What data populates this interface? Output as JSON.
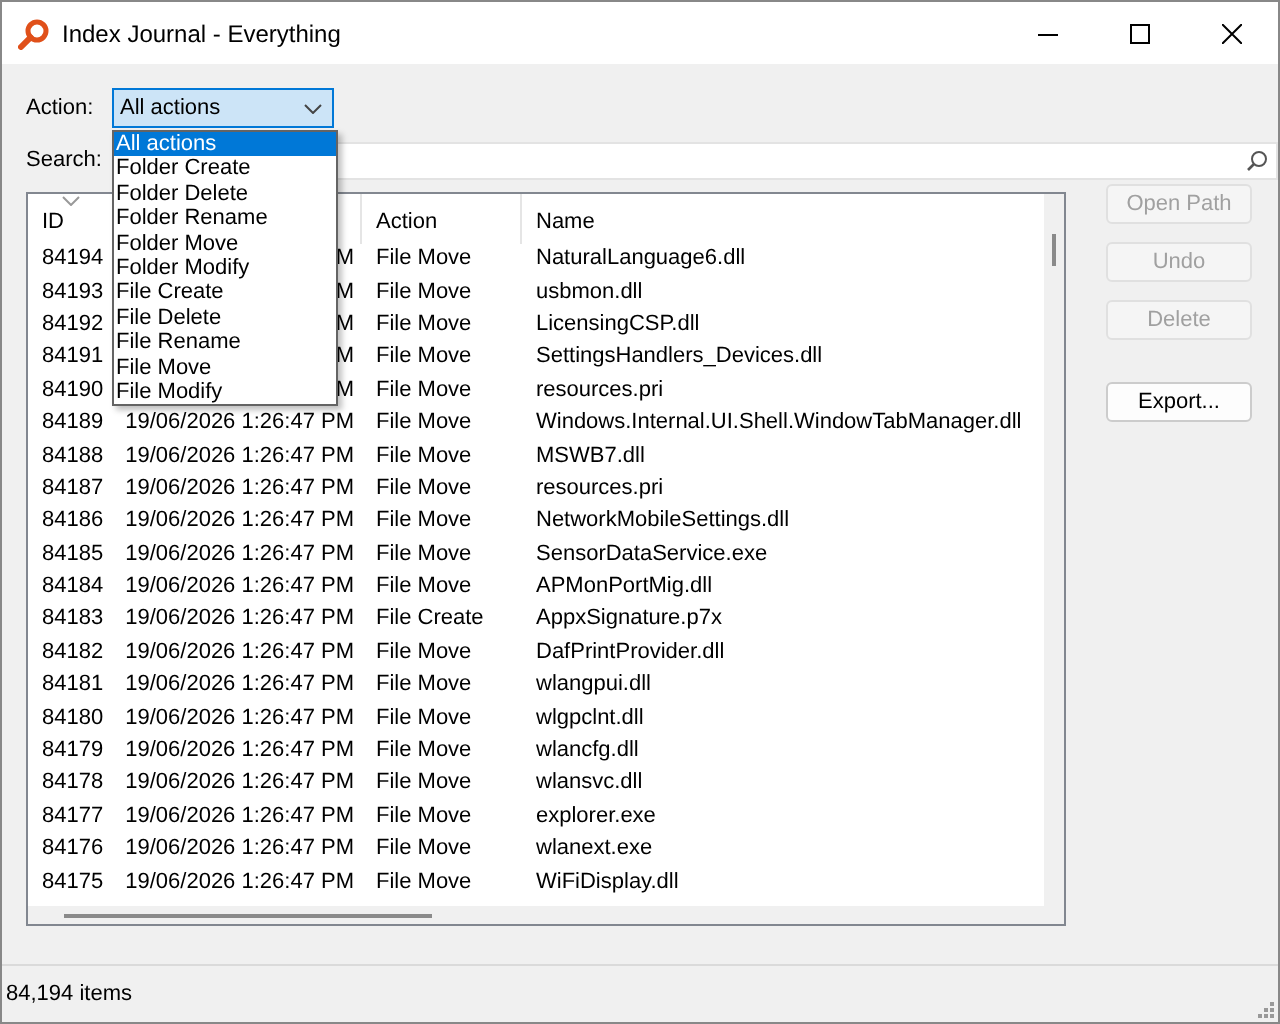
{
  "window": {
    "title": "Index Journal - Everything"
  },
  "action_filter": {
    "label": "Action:",
    "value": "All actions",
    "expanded": true,
    "options": [
      {
        "label": "All actions",
        "selected": true
      },
      {
        "label": "Folder Create",
        "selected": false
      },
      {
        "label": "Folder Delete",
        "selected": false
      },
      {
        "label": "Folder Rename",
        "selected": false
      },
      {
        "label": "Folder Move",
        "selected": false
      },
      {
        "label": "Folder Modify",
        "selected": false
      },
      {
        "label": "File Create",
        "selected": false
      },
      {
        "label": "File Delete",
        "selected": false
      },
      {
        "label": "File Rename",
        "selected": false
      },
      {
        "label": "File Move",
        "selected": false
      },
      {
        "label": "File Modify",
        "selected": false
      }
    ]
  },
  "search": {
    "label": "Search:"
  },
  "table": {
    "columns": [
      "ID",
      "",
      "Action",
      "Name"
    ],
    "rows": [
      {
        "id": "84194",
        "date": "M",
        "action": "File Move",
        "name": "NaturalLanguage6.dll"
      },
      {
        "id": "84193",
        "date": "M",
        "action": "File Move",
        "name": "usbmon.dll"
      },
      {
        "id": "84192",
        "date": "M",
        "action": "File Move",
        "name": "LicensingCSP.dll"
      },
      {
        "id": "84191",
        "date": "M",
        "action": "File Move",
        "name": "SettingsHandlers_Devices.dll"
      },
      {
        "id": "84190",
        "date": "M",
        "action": "File Move",
        "name": "resources.pri"
      },
      {
        "id": "84189",
        "date": "19/06/2026 1:26:47 PM",
        "action": "File Move",
        "name": "Windows.Internal.UI.Shell.WindowTabManager.dll"
      },
      {
        "id": "84188",
        "date": "19/06/2026 1:26:47 PM",
        "action": "File Move",
        "name": "MSWB7.dll"
      },
      {
        "id": "84187",
        "date": "19/06/2026 1:26:47 PM",
        "action": "File Move",
        "name": "resources.pri"
      },
      {
        "id": "84186",
        "date": "19/06/2026 1:26:47 PM",
        "action": "File Move",
        "name": "NetworkMobileSettings.dll"
      },
      {
        "id": "84185",
        "date": "19/06/2026 1:26:47 PM",
        "action": "File Move",
        "name": "SensorDataService.exe"
      },
      {
        "id": "84184",
        "date": "19/06/2026 1:26:47 PM",
        "action": "File Move",
        "name": "APMonPortMig.dll"
      },
      {
        "id": "84183",
        "date": "19/06/2026 1:26:47 PM",
        "action": "File Create",
        "name": "AppxSignature.p7x"
      },
      {
        "id": "84182",
        "date": "19/06/2026 1:26:47 PM",
        "action": "File Move",
        "name": "DafPrintProvider.dll"
      },
      {
        "id": "84181",
        "date": "19/06/2026 1:26:47 PM",
        "action": "File Move",
        "name": "wlangpui.dll"
      },
      {
        "id": "84180",
        "date": "19/06/2026 1:26:47 PM",
        "action": "File Move",
        "name": "wlgpclnt.dll"
      },
      {
        "id": "84179",
        "date": "19/06/2026 1:26:47 PM",
        "action": "File Move",
        "name": "wlancfg.dll"
      },
      {
        "id": "84178",
        "date": "19/06/2026 1:26:47 PM",
        "action": "File Move",
        "name": "wlansvc.dll"
      },
      {
        "id": "84177",
        "date": "19/06/2026 1:26:47 PM",
        "action": "File Move",
        "name": "explorer.exe"
      },
      {
        "id": "84176",
        "date": "19/06/2026 1:26:47 PM",
        "action": "File Move",
        "name": "wlanext.exe"
      },
      {
        "id": "84175",
        "date": "19/06/2026 1:26:47 PM",
        "action": "File Move",
        "name": "WiFiDisplay.dll"
      }
    ]
  },
  "buttons": [
    {
      "label": "Open Path",
      "disabled": true
    },
    {
      "label": "Undo",
      "disabled": true
    },
    {
      "label": "Delete",
      "disabled": true
    },
    {
      "label": "Export...",
      "disabled": false
    }
  ],
  "status_bar": "84,194 items"
}
